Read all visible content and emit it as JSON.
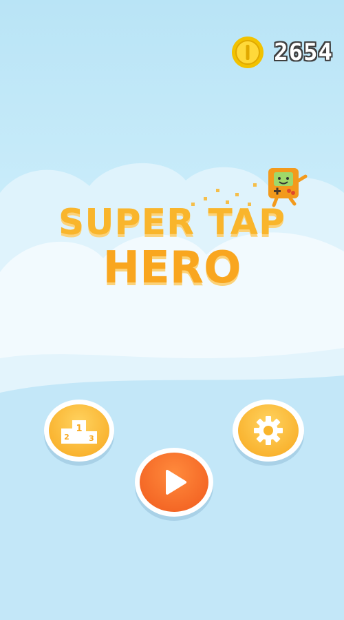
{
  "app": {
    "title_line1": "SUPER TAP",
    "title_line2": "HERO"
  },
  "coins": {
    "value": "2654",
    "icon": "coin-icon"
  },
  "buttons": {
    "leaderboard": {
      "icon": "podium-icon",
      "ranks": [
        "1",
        "2",
        "3"
      ]
    },
    "settings": {
      "icon": "gear-icon"
    },
    "play": {
      "icon": "play-icon"
    }
  },
  "colors": {
    "title": "#f9b52c",
    "orange_button": "#f7a81f",
    "play_button": "#f05a1d",
    "coin": "#f2c200"
  }
}
